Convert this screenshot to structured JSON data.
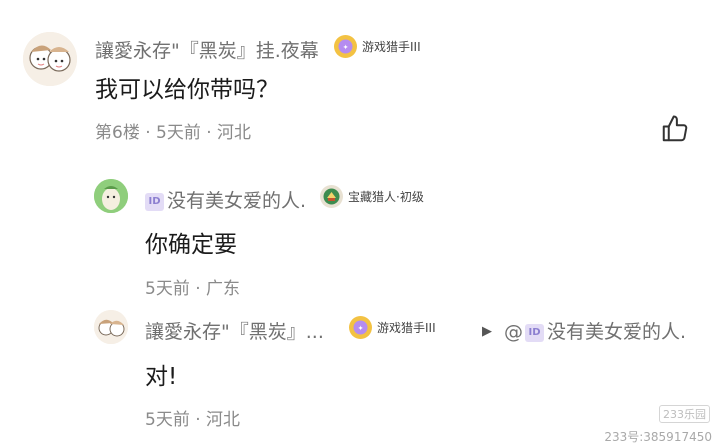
{
  "comments": [
    {
      "username": "讓愛永存\"『黑炭』挂.夜幕",
      "badge": {
        "text": "游戏猎手III",
        "icon": "game-hunter-icon",
        "color": "#f3c243"
      },
      "text": "我可以给你带吗？",
      "meta": "第6楼 · 5天前 · 河北"
    }
  ],
  "replies": [
    {
      "username": "没有美女爱的人.",
      "id_icon_text": "ID",
      "badge": {
        "text": "宝藏猎人·初级",
        "icon": "treasure-hunter-icon",
        "color": "#3d8c4f"
      },
      "text": "你确定要",
      "meta": "5天前 · 广东"
    },
    {
      "username": "讓愛永存\"『黑炭』...",
      "badge": {
        "text": "游戏猎手III",
        "icon": "game-hunter-icon",
        "color": "#f3c243"
      },
      "reply_to": "@",
      "reply_to_id_icon": "ID",
      "reply_to_name": "没有美女爱的人.",
      "text": "对!",
      "meta": "5天前 · 河北"
    }
  ],
  "watermark": {
    "logo": "233乐园",
    "text": "233号:385917450"
  },
  "colors": {
    "accent_purple": "#8c7fd0",
    "meta_gray": "#8a8a8a"
  }
}
